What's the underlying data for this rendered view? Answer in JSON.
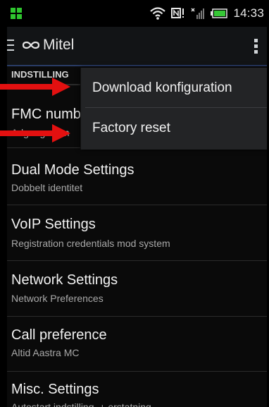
{
  "statusbar": {
    "time": "14:33",
    "icons": [
      "app-notification-icon",
      "wifi-icon",
      "nfc-icon",
      "signal-icon",
      "battery-icon"
    ]
  },
  "actionbar": {
    "brand": "Mitel",
    "icons": [
      "drawer-icon",
      "mitel-logo-icon",
      "overflow-menu-icon"
    ]
  },
  "list": {
    "section_header": "INDSTILLING",
    "items": [
      {
        "title": "FMC numb",
        "subtitle": "Adgangsnum"
      },
      {
        "title": "Dual Mode Settings",
        "subtitle": "Dobbelt identitet"
      },
      {
        "title": "VoIP Settings",
        "subtitle": "Registration credentials mod system"
      },
      {
        "title": "Network Settings",
        "subtitle": "Network Preferences"
      },
      {
        "title": "Call preference",
        "subtitle": "Altid Aastra MC"
      },
      {
        "title": "Misc. Settings",
        "subtitle": "Autostart indstilling, + erstatning"
      }
    ]
  },
  "popup_menu": {
    "items": [
      "Download konfiguration",
      "Factory reset"
    ]
  },
  "colors": {
    "annotation_arrow": "#e31010",
    "accent_underline": "#2a3c66"
  }
}
